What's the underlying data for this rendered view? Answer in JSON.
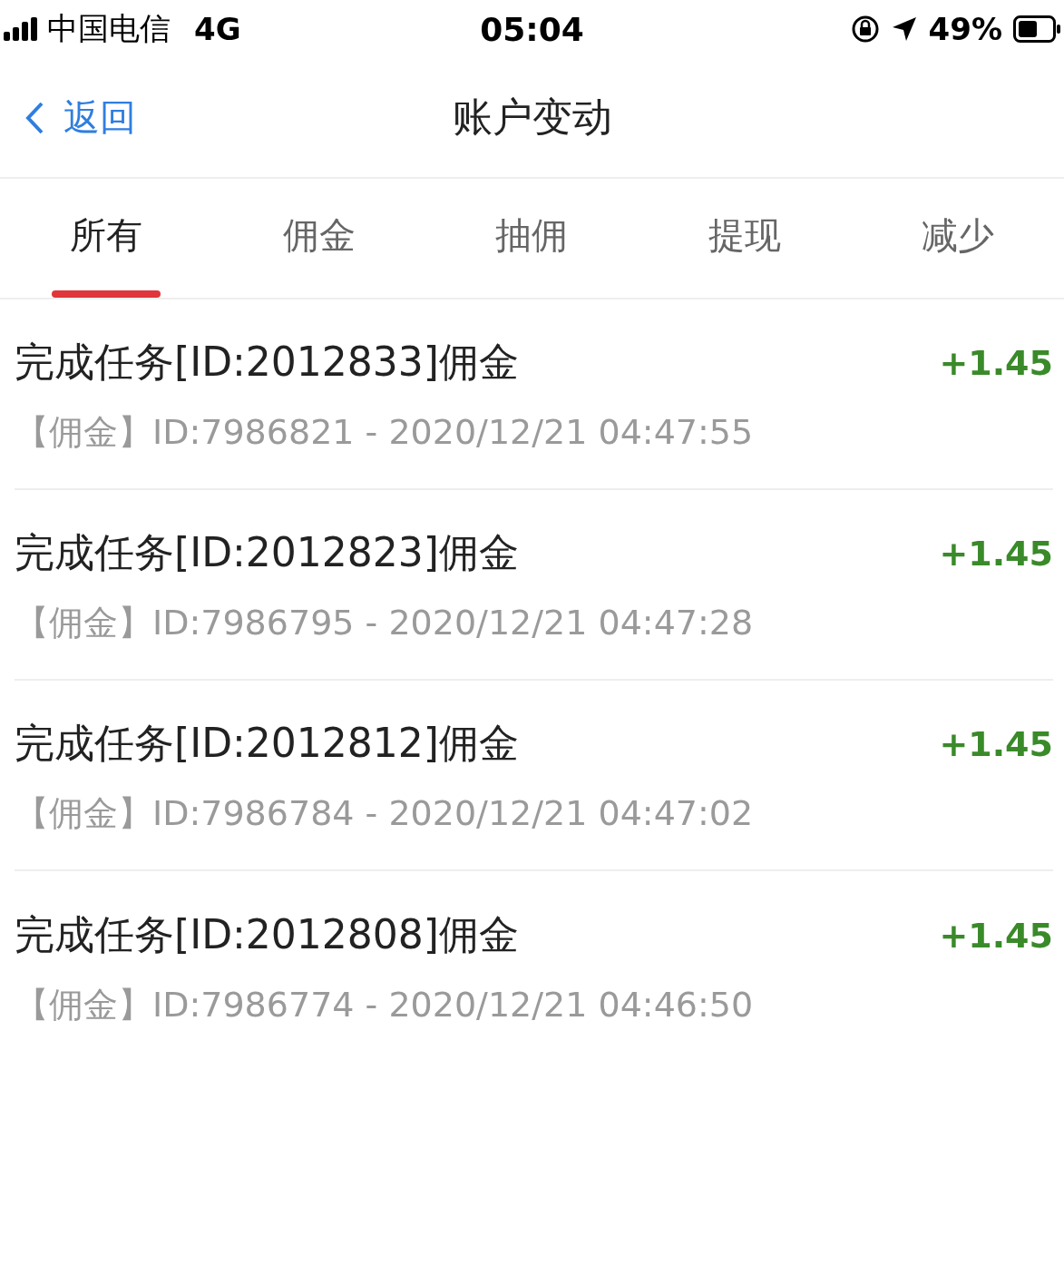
{
  "status_bar": {
    "carrier": "中国电信",
    "network": "4G",
    "time": "05:04",
    "battery": "49%"
  },
  "nav": {
    "back": "返回",
    "title": "账户变动"
  },
  "tabs": [
    {
      "label": "所有",
      "selected": true
    },
    {
      "label": "佣金",
      "selected": false
    },
    {
      "label": "抽佣",
      "selected": false
    },
    {
      "label": "提现",
      "selected": false
    },
    {
      "label": "减少",
      "selected": false
    }
  ],
  "entries": [
    {
      "title": "完成任务[ID:2012833]佣金",
      "detail": "【佣金】ID:7986821 - 2020/12/21 04:47:55",
      "amount": "+1.45"
    },
    {
      "title": "完成任务[ID:2012823]佣金",
      "detail": "【佣金】ID:7986795 - 2020/12/21 04:47:28",
      "amount": "+1.45"
    },
    {
      "title": "完成任务[ID:2012812]佣金",
      "detail": "【佣金】ID:7986784 - 2020/12/21 04:47:02",
      "amount": "+1.45"
    },
    {
      "title": "完成任务[ID:2012808]佣金",
      "detail": "【佣金】ID:7986774 - 2020/12/21 04:46:50",
      "amount": "+1.45"
    }
  ]
}
